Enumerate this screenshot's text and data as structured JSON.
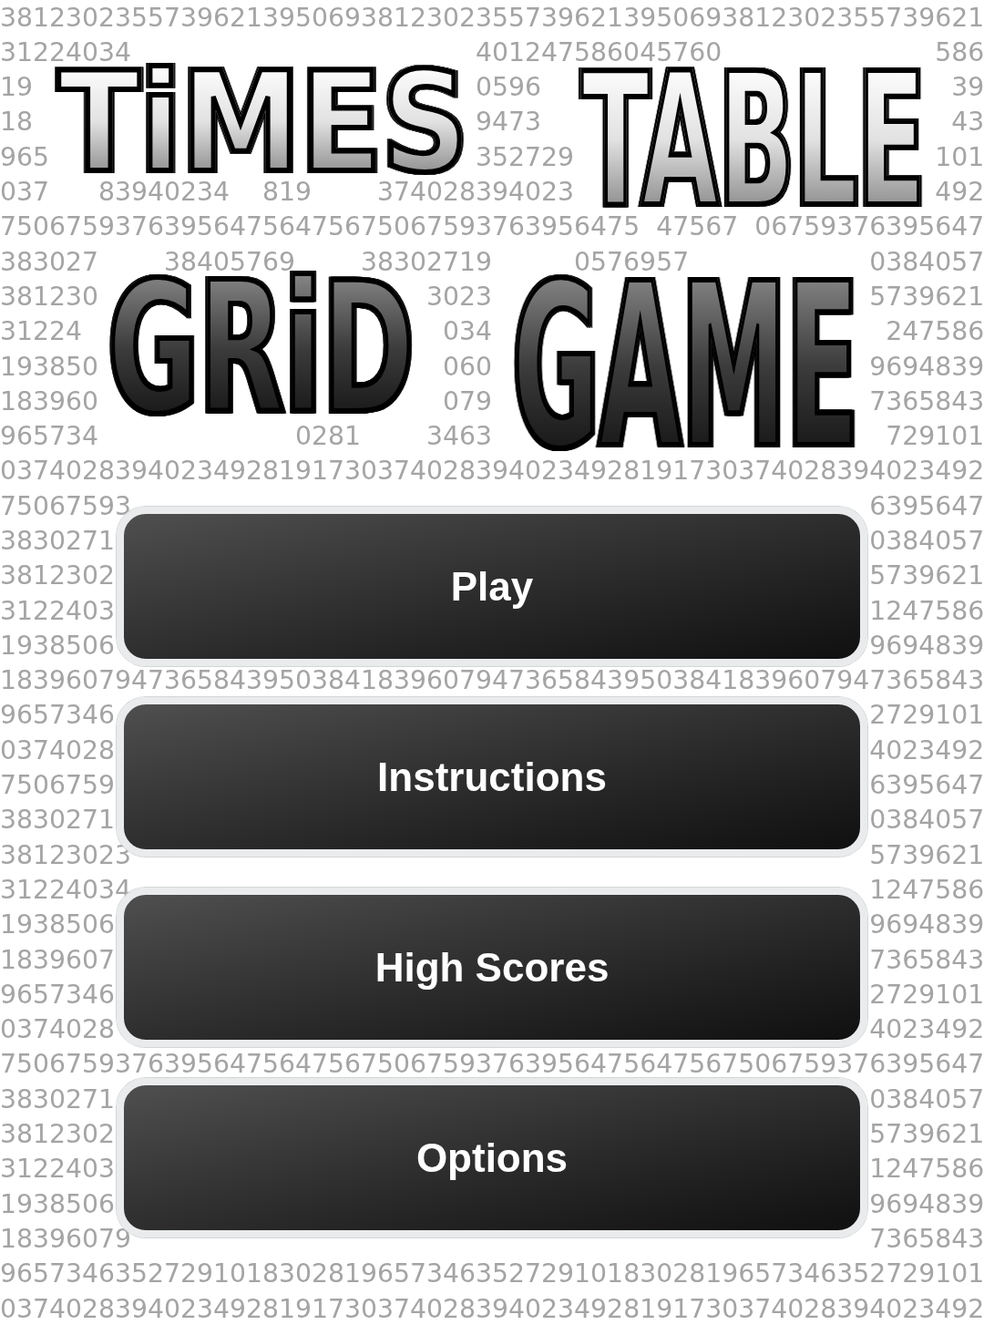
{
  "background_digits": {
    "rows": [
      "381230235573962139506938123023557396213950693812302355739621",
      "31224034                     401247586045760             586",
      "19                           0596                         39",
      "18                           9473                         43",
      "965                          352729                      101",
      "037   83940234  819    374028394023                      492",
      "750675937639564756475675067593763956475 47567 06759376395647",
      "383027    38405769    38302719     0576957           0384057",
      "381230                    3023                       5739621",
      "31224                      034                        247586",
      "193850                     060                       9694839",
      "183960                     079                       7365843",
      "965734            0281    3463                        729101",
      "037402839402349281917303740283940234928191730374028394023492",
      "75067593                                             6395647",
      "3830271                                              0384057",
      "3812302                                              5739621",
      "3122403                                              1247586",
      "1938506                                              9694839",
      "183960794736584395038418396079473658439503841839607947365843",
      "9657346                                              2729101",
      "0374028                                              4023492",
      "7506759                                              6395647",
      "3830271                                              0384057",
      "38123023                                             5739621",
      "31224034                                             1247586",
      "1938506                                              9694839",
      "1839607                                              7365843",
      "9657346                                              2729101",
      "0374028                                              4023492",
      "750675937639564756475675067593763956475647567506759376395647",
      "3830271                                              0384057",
      "3812302                                              5739621",
      "3122403                                              1247586",
      "1938506                                              9694839",
      "18396079                                             7365843",
      "965734635272910183028196573463527291018302819657346352729101",
      "037402839402349281917303740283940234928191730374028394023492"
    ]
  },
  "logo": {
    "top_line": [
      "TiMES",
      "TABLE"
    ],
    "bottom_line": [
      "GRiD",
      "GAME"
    ]
  },
  "menu_buttons": [
    "Play",
    "Instructions",
    "High Scores",
    "Options"
  ]
}
